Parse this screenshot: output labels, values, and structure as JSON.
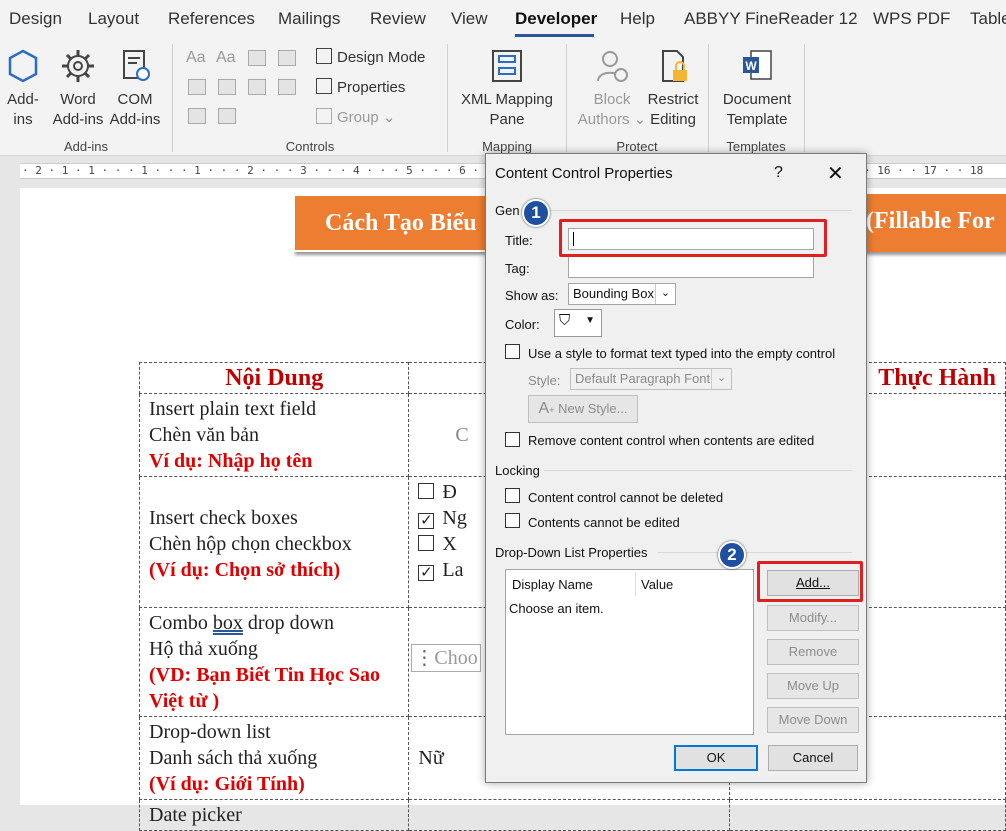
{
  "tabs": [
    "Design",
    "Layout",
    "References",
    "Mailings",
    "Review",
    "View",
    "Developer",
    "Help",
    "ABBYY FineReader 12",
    "WPS PDF",
    "Table"
  ],
  "ribbon": {
    "addins": {
      "line1": "Add-",
      "line2": "ins"
    },
    "word_addins": {
      "line1": "Word",
      "line2": "Add-ins"
    },
    "com_addins": {
      "line1": "COM",
      "line2": "Add-ins"
    },
    "group_addins": "Add-ins",
    "design_mode": "Design Mode",
    "properties": "Properties",
    "group": "Group",
    "group_controls": "Controls",
    "xml_mapping": {
      "line1": "XML Mapping",
      "line2": "Pane"
    },
    "group_mapping": "Mapping",
    "block_authors": {
      "line1": "Block",
      "line2": "Authors"
    },
    "restrict_editing": {
      "line1": "Restrict",
      "line2": "Editing"
    },
    "group_protect": "Protect",
    "document_template": {
      "line1": "Document",
      "line2": "Template"
    },
    "group_templates": "Templates"
  },
  "ruler": {
    "left": "· 2 · 1 · 1 · · · 1 · · · 1 · · · 2 · · · 3 · · · 4 · · · 5 · · · 6 · ·7",
    "right": "· 16 · · 17 · · 18"
  },
  "document": {
    "banner_left": "Cách Tạo Biểu",
    "banner_right": "(Fillable For",
    "header_col1": "Nội Dung",
    "header_col3": "Thực Hành",
    "row1": {
      "l1": "Insert plain text field",
      "l2": "Chèn văn bản",
      "l3": "Ví dụ: Nhập họ tên",
      "mid": "C"
    },
    "row2": {
      "l1": "Insert check boxes",
      "l2": "Chèn hộp chọn checkbox",
      "l3": "(Ví dụ: Chọn sở thích)",
      "cb1": "Đ",
      "cb2": "Ng",
      "cb3": "X",
      "cb4": "La"
    },
    "row3": {
      "l1_a": "Combo ",
      "l1_b": "box",
      "l1_c": " drop down",
      "l2": "Hộ thả xuống",
      "l3": "(VD: Bạn Biết Tin Học Sao Việt từ )",
      "mid": "Choo"
    },
    "row4": {
      "l1": "Drop-down list",
      "l2": "Danh sách thả xuống",
      "l3": "(Ví dụ: Giới Tính)",
      "mid": "Nữ"
    },
    "row5": {
      "l1": "Date picker"
    }
  },
  "dialog": {
    "title": "Content Control Properties",
    "help": "?",
    "close": "✕",
    "general": "Gen",
    "title_label": "Title:",
    "title_value": "",
    "tag_label": "Tag:",
    "show_as_label": "Show as:",
    "show_as_value": "Bounding Box",
    "color_label": "Color:",
    "use_style": "Use a style to format text typed into the empty control",
    "style_label": "Style:",
    "style_value": "Default Paragraph Font",
    "new_style": "New Style...",
    "remove_cc": "Remove content control when contents are edited",
    "locking": "Locking",
    "lock_delete": "Content control cannot be deleted",
    "lock_edit": "Contents cannot be edited",
    "ddl_props": "Drop-Down List Properties",
    "col_display": "Display Name",
    "col_value": "Value",
    "list_item": "Choose an item.",
    "btn_add": "Add...",
    "btn_modify": "Modify...",
    "btn_remove": "Remove",
    "btn_moveup": "Move Up",
    "btn_movedown": "Move Down",
    "btn_ok": "OK",
    "btn_cancel": "Cancel"
  },
  "annotations": {
    "step1": "1",
    "step2": "2"
  },
  "colors": {
    "accent": "#2b579a",
    "highlight": "#e02020",
    "banner": "#ed7d31",
    "red_text": "#e00000"
  }
}
